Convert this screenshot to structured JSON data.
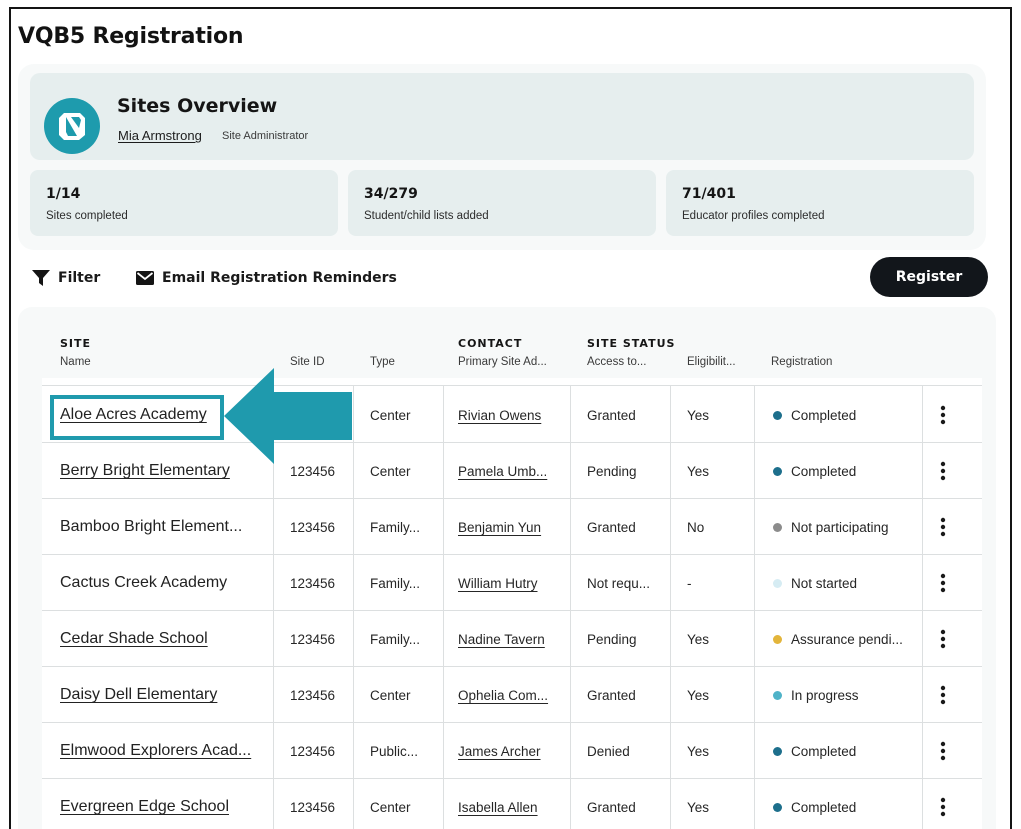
{
  "page": {
    "title": "VQB5 Registration"
  },
  "overview": {
    "title": "Sites Overview",
    "admin_name": "Mia Armstrong",
    "admin_role": "Site Administrator",
    "logo_icon": "brand-logo-icon"
  },
  "stats": [
    {
      "value": "1/14",
      "label": "Sites completed"
    },
    {
      "value": "34/279",
      "label": "Student/child lists added"
    },
    {
      "value": "71/401",
      "label": "Educator profiles completed"
    }
  ],
  "toolbar": {
    "filter_label": "Filter",
    "filter_icon": "filter-icon",
    "email_label": "Email Registration Reminders",
    "email_icon": "envelope-icon",
    "register_label": "Register"
  },
  "table": {
    "groups": {
      "site": "SITE",
      "contact": "CONTACT",
      "site_status": "SITE STATUS"
    },
    "columns": {
      "name": "Name",
      "site_id": "Site ID",
      "type": "Type",
      "primary_site_admin": "Primary Site Ad...",
      "access": "Access to...",
      "eligibility": "Eligibilit...",
      "registration": "Registration"
    },
    "rows": [
      {
        "name": "Aloe Acres Academy",
        "site_id": "",
        "type": "Center",
        "contact": "Rivian Owens",
        "access": "Granted",
        "eligibility": "Yes",
        "registration": "Completed"
      },
      {
        "name": "Berry Bright Elementary",
        "site_id": "123456",
        "type": "Center",
        "contact": "Pamela Umb...",
        "access": "Pending",
        "eligibility": "Yes",
        "registration": "Completed"
      },
      {
        "name": "Bamboo Bright Element...",
        "site_id": "123456",
        "type": "Family...",
        "contact": "Benjamin Yun",
        "access": "Granted",
        "eligibility": "No",
        "registration": "Not participating"
      },
      {
        "name": "Cactus Creek Academy",
        "site_id": "123456",
        "type": "Family...",
        "contact": "William Hutry",
        "access": "Not requ...",
        "eligibility": "-",
        "registration": "Not started"
      },
      {
        "name": "Cedar Shade School",
        "site_id": "123456",
        "type": "Family...",
        "contact": "Nadine Tavern",
        "access": "Pending",
        "eligibility": "Yes",
        "registration": "Assurance pendi..."
      },
      {
        "name": "Daisy Dell Elementary",
        "site_id": "123456",
        "type": "Center",
        "contact": "Ophelia Com...",
        "access": "Granted",
        "eligibility": "Yes",
        "registration": "In progress"
      },
      {
        "name": "Elmwood Explorers Acad...",
        "site_id": "123456",
        "type": "Public...",
        "contact": "James Archer",
        "access": "Denied",
        "eligibility": "Yes",
        "registration": "Completed"
      },
      {
        "name": "Evergreen Edge School",
        "site_id": "123456",
        "type": "Center",
        "contact": "Isabella Allen",
        "access": "Granted",
        "eligibility": "Yes",
        "registration": "Completed"
      }
    ],
    "row_actions_icon": "kebab-menu-icon"
  },
  "status_colors": {
    "Completed": "#1d6f8c",
    "Not participating": "#8c8c8c",
    "Not started": "#d6ecf3",
    "Assurance pendi...": "#e3b53b",
    "In progress": "#4fb3c8"
  },
  "annotation": {
    "highlight_color": "#1f9aad",
    "arrow_icon": "left-arrow-annotation"
  }
}
